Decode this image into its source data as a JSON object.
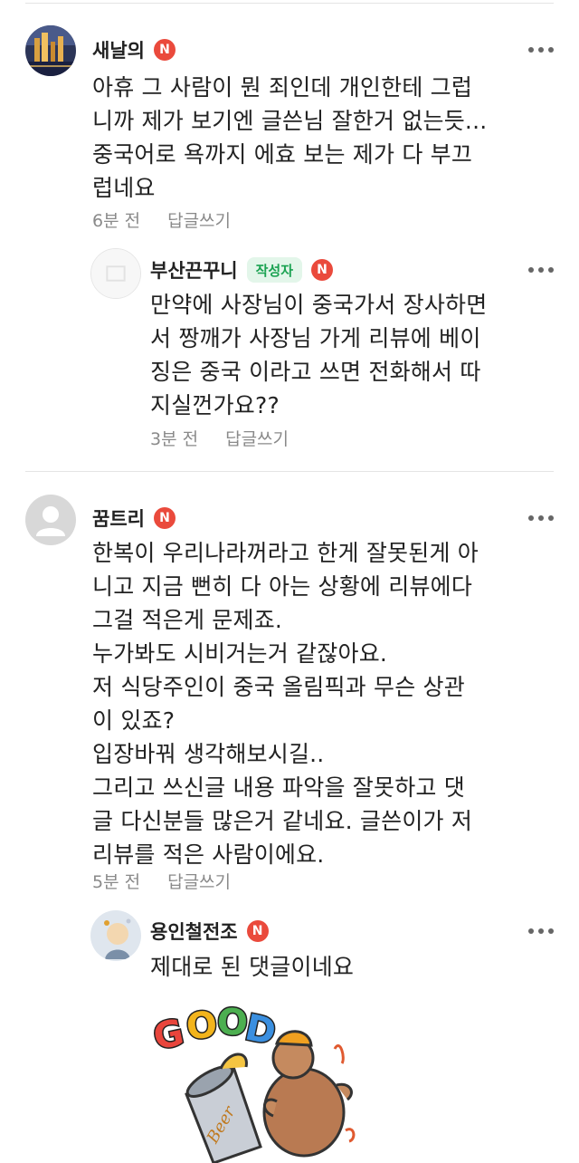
{
  "comments": [
    {
      "author": "새날의",
      "badge": "N",
      "lines": [
        "아휴 그 사람이 뭔 죄인데 개인한테 그럽",
        "니까 제가 보기엔 글쓴님 잘한거 없는듯...",
        "중국어로 욕까지 에효 보는 제가 다 부끄",
        "럽네요"
      ],
      "time": "6분 전",
      "reply_label": "답글쓰기",
      "avatar_icon": "city-night-avatar-icon"
    },
    {
      "author": "부산끈꾸니",
      "writer_label": "작성자",
      "badge": "N",
      "lines": [
        "만약에 사장님이 중국가서 장사하면",
        "서 짱깨가 사장님 가게 리뷰에 베이",
        "징은 중국 이라고 쓰면 전화해서 따",
        "지실껀가요??"
      ],
      "time": "3분 전",
      "reply_label": "답글쓰기",
      "avatar_icon": "blank-avatar-icon"
    },
    {
      "author": "꿈트리",
      "badge": "N",
      "lines": [
        "한복이 우리나라꺼라고 한게 잘못된게 아",
        "니고 지금 뻔히 다 아는 상황에 리뷰에다",
        "그걸 적은게 문제죠.",
        "누가봐도 시비거는거 같잖아요.",
        "저 식당주인이 중국 올림픽과 무슨 상관",
        "이 있죠?",
        "입장바꿔 생각해보시길..",
        "그리고 쓰신글 내용 파악을 잘못하고 댓",
        "글 다신분들 많은거 같네요. 글쓴이가 저",
        "리뷰를 적은 사람이에요."
      ],
      "time": "5분 전",
      "reply_label": "답글쓰기",
      "avatar_icon": "default-user-avatar-icon"
    },
    {
      "author": "용인철전조",
      "badge": "N",
      "lines": [
        "제대로 된 댓글이네요"
      ],
      "avatar_icon": "cartoon-avatar-icon"
    }
  ],
  "sticker": {
    "good_text": "GOOD",
    "beer_text": "Beer",
    "icon": "good-chicken-beer-sticker-icon"
  },
  "colors": {
    "new_badge": "#ea4a3c",
    "writer_badge_bg": "#e3f6ea",
    "writer_badge_text": "#1aa251",
    "meta_text": "#8a8a8a"
  }
}
